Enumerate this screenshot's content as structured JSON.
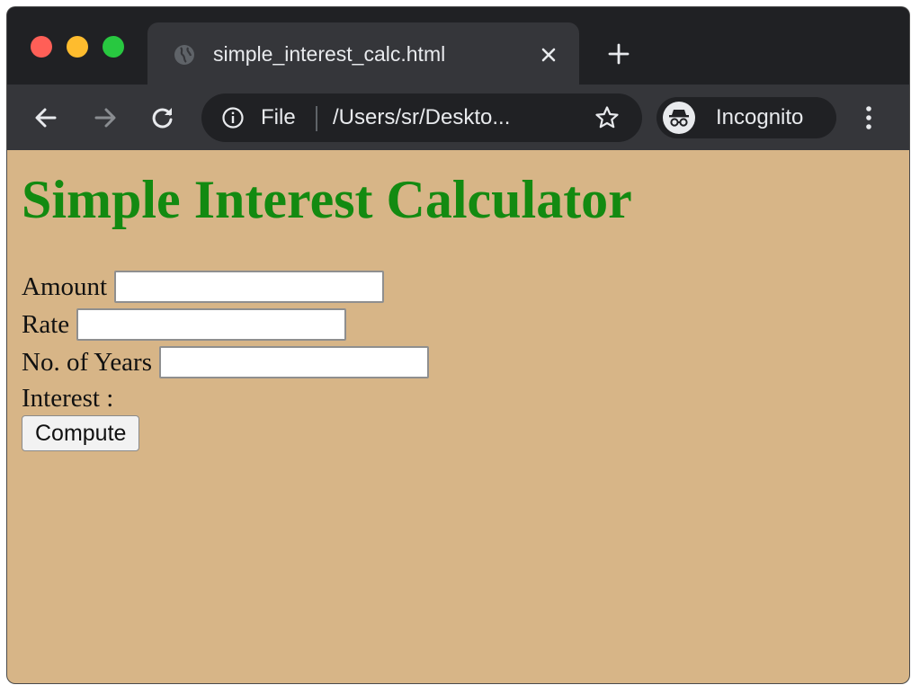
{
  "browser": {
    "tab": {
      "title": "simple_interest_calc.html",
      "favicon": "globe-icon"
    },
    "toolbar": {
      "scheme_label": "File",
      "url": "/Users/sr/Deskto...",
      "profile_label": "Incognito"
    },
    "colors": {
      "frame": "#202124",
      "toolbar": "#35363a",
      "close_light": "#ff5f57",
      "minimize_light": "#febc2e",
      "zoom_light": "#28c840"
    }
  },
  "page": {
    "title": "Simple Interest Calculator",
    "background": "#d7b587",
    "title_color": "#138a11",
    "form": {
      "amount_label": "Amount",
      "amount_value": "",
      "rate_label": "Rate",
      "rate_value": "",
      "years_label": "No. of Years",
      "years_value": "",
      "interest_label": "Interest :",
      "interest_value": "",
      "compute_label": "Compute"
    }
  }
}
